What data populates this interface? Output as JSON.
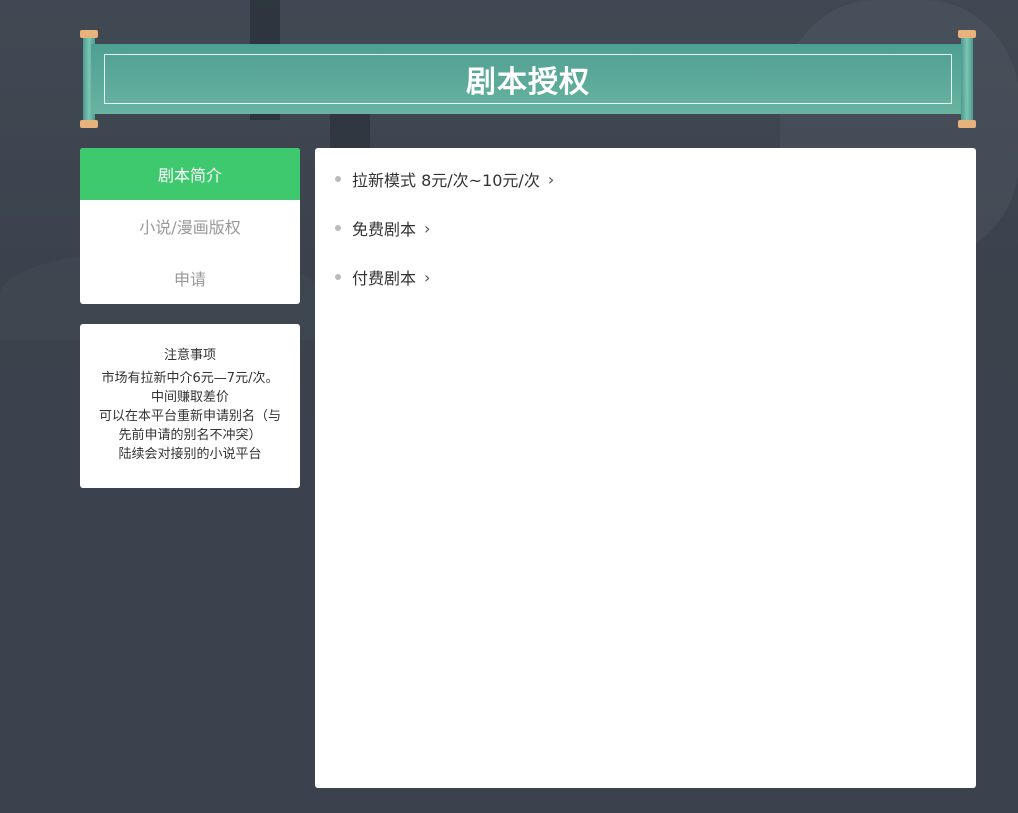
{
  "banner": {
    "title": "剧本授权"
  },
  "nav": {
    "items": [
      {
        "label": "剧本简介",
        "active": true
      },
      {
        "label": "小说/漫画版权",
        "active": false
      },
      {
        "label": "申请",
        "active": false
      }
    ]
  },
  "notice": {
    "title": "注意事项",
    "lines": [
      "市场有拉新中介6元—7元/次。",
      "中间赚取差价",
      "可以在本平台重新申请别名（与",
      "先前申请的别名不冲突）",
      "陆续会对接别的小说平台"
    ]
  },
  "content": {
    "items": [
      {
        "label": "拉新模式 8元/次~10元/次",
        "icon": "chevron-right-icon"
      },
      {
        "label": "免费剧本",
        "icon": "chevron-right-icon"
      },
      {
        "label": "付费剧本",
        "icon": "chevron-right-icon"
      }
    ]
  },
  "colors": {
    "accent": "#3ec96e",
    "banner": "#5aa898",
    "background": "#3b424d"
  }
}
